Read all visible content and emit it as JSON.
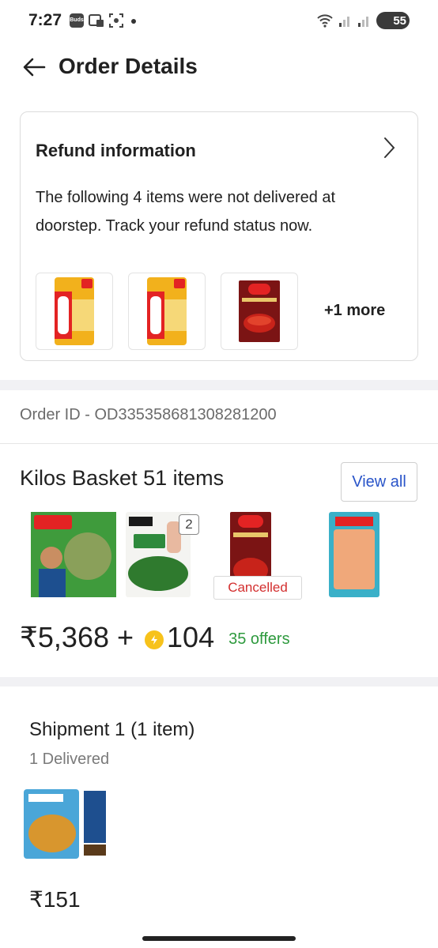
{
  "status_bar": {
    "time": "7:27",
    "buds_label": "Buds",
    "battery": "55"
  },
  "header": {
    "title": "Order Details",
    "back_icon": "arrow-left-icon"
  },
  "refund": {
    "title": "Refund information",
    "message": "The following 4 items were not delivered at doorstep. Track your refund status now.",
    "more_label": "+1 more",
    "thumbnails": [
      "fortune-oil-pack",
      "fortune-oil-pack",
      "catch-kashmiri-mirch-powder"
    ]
  },
  "order": {
    "id_text": "Order ID - OD335358681308281200"
  },
  "basket": {
    "title": "Kilos Basket 51 items",
    "view_all_label": "View all",
    "qty_badge": "2",
    "cancelled_label": "Cancelled",
    "price": "₹5,368 +",
    "supercoins": "104",
    "offers": "35 offers",
    "coin_color": "#f7c21b",
    "offers_color": "#2e9a3e"
  },
  "shipment": {
    "title": "Shipment 1 (1 item)",
    "status": "1 Delivered",
    "price": "₹151"
  }
}
